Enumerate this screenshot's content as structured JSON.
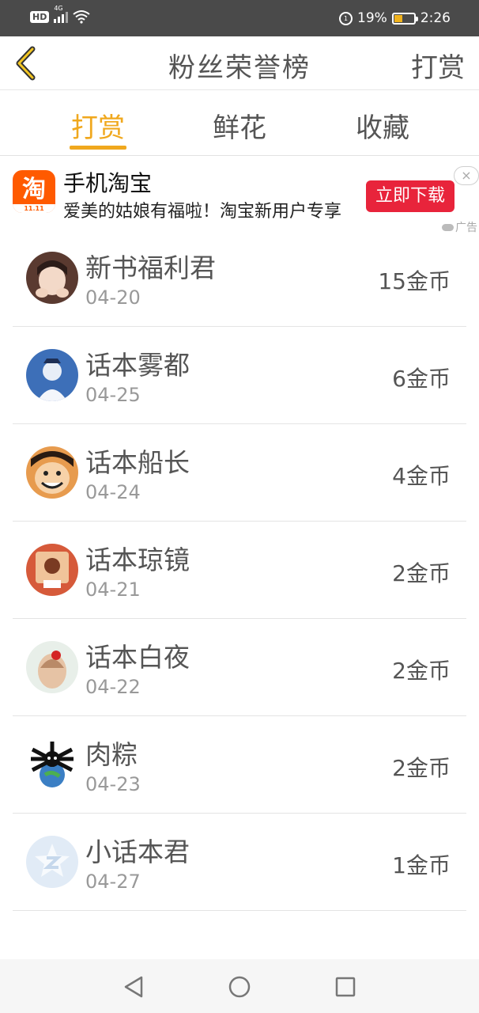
{
  "status": {
    "hd": "HD",
    "network": "4G",
    "battery": "19%",
    "battery_level": 0.19,
    "time": "2:26"
  },
  "header": {
    "title": "粉丝荣誉榜",
    "action": "打赏",
    "back_icon": "chevron-left-icon"
  },
  "tabs": [
    {
      "label": "打赏",
      "active": true
    },
    {
      "label": "鲜花",
      "active": false
    },
    {
      "label": "收藏",
      "active": false
    }
  ],
  "ad": {
    "logo_text": "淘",
    "logo_tag": "11.11",
    "name": "手机淘宝",
    "description": "爱美的姑娘有福啦！淘宝新用户专享",
    "button": "立即下载",
    "close": "×",
    "label": "广告"
  },
  "fans": [
    {
      "name": "新书福利君",
      "date": "04-20",
      "amount": "15金币"
    },
    {
      "name": "话本雾都",
      "date": "04-25",
      "amount": "6金币"
    },
    {
      "name": "话本船长",
      "date": "04-24",
      "amount": "4金币"
    },
    {
      "name": "话本琼镜",
      "date": "04-21",
      "amount": "2金币"
    },
    {
      "name": "话本白夜",
      "date": "04-22",
      "amount": "2金币"
    },
    {
      "name": "肉粽",
      "date": "04-23",
      "amount": "2金币"
    },
    {
      "name": "小话本君",
      "date": "04-27",
      "amount": "1金币"
    }
  ],
  "colors": {
    "accent": "#f0a81e",
    "ad_button": "#e8243b",
    "taobao": "#ff5a00"
  }
}
